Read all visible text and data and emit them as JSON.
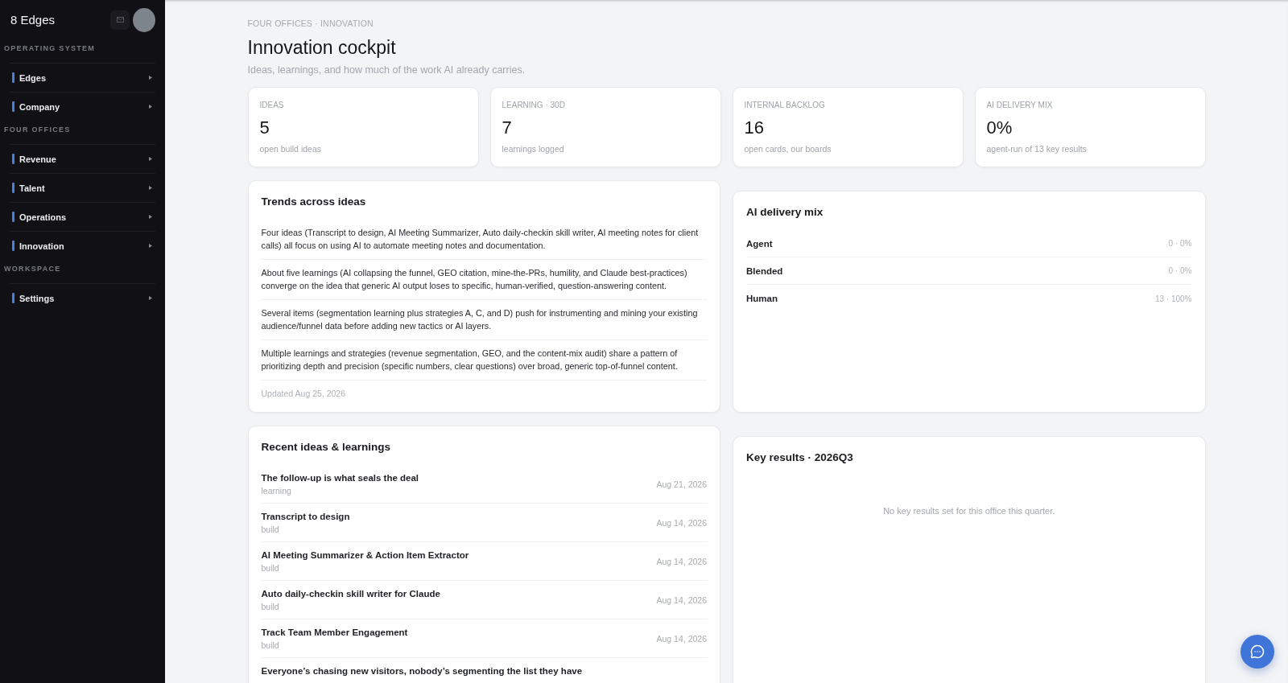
{
  "sidebar": {
    "brand": "8 Edges",
    "sections": [
      {
        "label": "OPERATING SYSTEM",
        "items": [
          {
            "label": "Edges"
          },
          {
            "label": "Company"
          }
        ]
      },
      {
        "label": "FOUR OFFICES",
        "items": [
          {
            "label": "Revenue"
          },
          {
            "label": "Talent"
          },
          {
            "label": "Operations"
          },
          {
            "label": "Innovation"
          }
        ]
      },
      {
        "label": "WORKSPACE",
        "items": [
          {
            "label": "Settings"
          }
        ]
      }
    ]
  },
  "header": {
    "breadcrumb": "FOUR OFFICES · INNOVATION",
    "title": "Innovation cockpit",
    "subtitle": "Ideas, learnings, and how much of the work AI already carries."
  },
  "stats": [
    {
      "label": "IDEAS",
      "value": "5",
      "caption": "open build ideas"
    },
    {
      "label": "LEARNING · 30D",
      "value": "7",
      "caption": "learnings logged"
    },
    {
      "label": "INTERNAL BACKLOG",
      "value": "16",
      "caption": "open cards, our boards"
    },
    {
      "label": "AI DELIVERY MIX",
      "value": "0%",
      "caption": "agent-run of 13 key results"
    }
  ],
  "trends": {
    "title": "Trends across ideas",
    "items": [
      "Four ideas (Transcript to design, AI Meeting Summarizer, Auto daily-checkin skill writer, AI meeting notes for client calls) all focus on using AI to automate meeting notes and documentation.",
      "About five learnings (AI collapsing the funnel, GEO citation, mine-the-PRs, humility, and Claude best-practices) converge on the idea that generic AI output loses to specific, human-verified, question-answering content.",
      "Several items (segmentation learning plus strategies A, C, and D) push for instrumenting and mining your existing audience/funnel data before adding new tactics or AI layers.",
      "Multiple learnings and strategies (revenue segmentation, GEO, and the content-mix audit) share a pattern of prioritizing depth and precision (specific numbers, clear questions) over broad, generic top-of-funnel content."
    ],
    "updated": "Updated Aug 25, 2026"
  },
  "delivery_mix": {
    "title": "AI delivery mix",
    "rows": [
      {
        "label": "Agent",
        "value": "0 · 0%"
      },
      {
        "label": "Blended",
        "value": "0 · 0%"
      },
      {
        "label": "Human",
        "value": "13 · 100%"
      }
    ]
  },
  "recent": {
    "title": "Recent ideas & learnings",
    "items": [
      {
        "title": "The follow-up is what seals the deal",
        "category": "learning",
        "date": "Aug 21, 2026"
      },
      {
        "title": "Transcript to design",
        "category": "build",
        "date": "Aug 14, 2026"
      },
      {
        "title": "AI Meeting Summarizer & Action Item Extractor",
        "category": "build",
        "date": "Aug 14, 2026"
      },
      {
        "title": "Auto daily-checkin skill writer for Claude",
        "category": "build",
        "date": "Aug 14, 2026"
      },
      {
        "title": "Track Team Member Engagement",
        "category": "build",
        "date": "Aug 14, 2026"
      },
      {
        "title": "Everyone’s chasing new visitors, nobody’s segmenting the list they have"
      }
    ]
  },
  "key_results": {
    "title": "Key results · 2026Q3",
    "empty_message": "No key results set for this office this quarter."
  }
}
